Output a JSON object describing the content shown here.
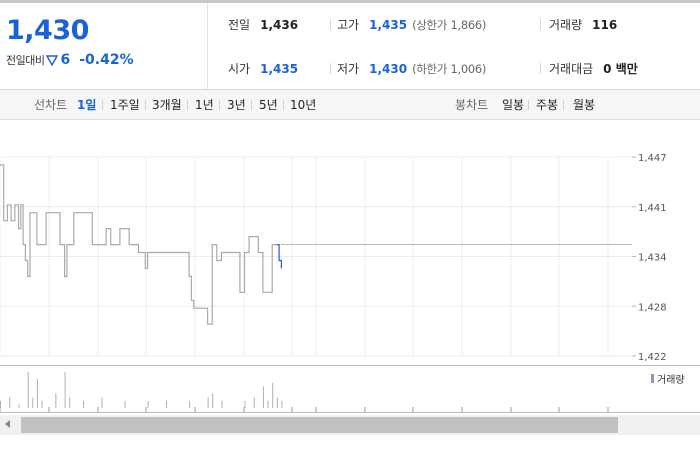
{
  "summary": {
    "current_price": "1,430",
    "change_label": "전일대비",
    "change_amount": "6",
    "change_pct": "-0.42%",
    "prev_close": {
      "label": "전일",
      "value": "1,436"
    },
    "open": {
      "label": "시가",
      "value": "1,435"
    },
    "high": {
      "label": "고가",
      "value": "1,435",
      "limit": "(상한가 1,866)"
    },
    "low": {
      "label": "저가",
      "value": "1,430",
      "limit": "(하한가 1,006)"
    },
    "volume": {
      "label": "거래량",
      "value": "116"
    },
    "trade_value": {
      "label": "거래대금",
      "value": "0 백만"
    }
  },
  "tabs": {
    "line_chart_label": "선차트",
    "line_chart_periods": [
      "1일",
      "1주일",
      "3개월",
      "1년",
      "3년",
      "5년",
      "10년"
    ],
    "candle_chart_label": "봉차트",
    "candle_chart_periods": [
      "일봉",
      "주봉",
      "월봉"
    ],
    "active_period": "1일"
  },
  "chart_data": {
    "type": "line",
    "y_ticks": [
      "1,447",
      "1,441",
      "1,434",
      "1,428",
      "1,422"
    ],
    "ylim": [
      1422,
      1447
    ],
    "prev_close_reference": 1436,
    "grid": true,
    "series": [
      {
        "points": [
          [
            0,
            1446
          ],
          [
            0.8,
            1439
          ],
          [
            1.6,
            1441
          ],
          [
            2.4,
            1439
          ],
          [
            3.2,
            1441
          ],
          [
            4,
            1438
          ],
          [
            4.5,
            1441
          ],
          [
            5,
            1436
          ],
          [
            5.5,
            1434
          ],
          [
            6,
            1432
          ],
          [
            6.5,
            1440
          ],
          [
            7,
            1440
          ],
          [
            8,
            1436
          ],
          [
            9,
            1436
          ],
          [
            10,
            1440
          ],
          [
            11,
            1440
          ],
          [
            12,
            1440
          ],
          [
            13,
            1436
          ],
          [
            14,
            1432
          ],
          [
            14.5,
            1436
          ],
          [
            15,
            1436
          ],
          [
            16,
            1440
          ],
          [
            17,
            1440
          ],
          [
            18,
            1440
          ],
          [
            19,
            1440
          ],
          [
            20,
            1436
          ],
          [
            21,
            1436
          ],
          [
            22,
            1436
          ],
          [
            23,
            1438
          ],
          [
            24,
            1436
          ],
          [
            25,
            1436
          ],
          [
            26,
            1438
          ],
          [
            27,
            1438
          ],
          [
            28,
            1436
          ],
          [
            29,
            1436
          ],
          [
            30,
            1435
          ],
          [
            31,
            1435
          ],
          [
            31.5,
            1433
          ],
          [
            32,
            1435
          ],
          [
            33,
            1435
          ],
          [
            34,
            1435
          ],
          [
            35,
            1435
          ],
          [
            36,
            1435
          ],
          [
            37,
            1435
          ],
          [
            38,
            1435
          ],
          [
            39,
            1435
          ],
          [
            40,
            1435
          ],
          [
            41,
            1432
          ],
          [
            41.5,
            1429
          ],
          [
            42,
            1428
          ],
          [
            43,
            1428
          ],
          [
            44,
            1428
          ],
          [
            45,
            1426
          ],
          [
            46,
            1436
          ],
          [
            47,
            1434
          ],
          [
            48,
            1435
          ],
          [
            49,
            1435
          ],
          [
            50,
            1435
          ],
          [
            51,
            1435
          ],
          [
            52,
            1430
          ],
          [
            53,
            1435
          ],
          [
            54,
            1437
          ],
          [
            55,
            1437
          ],
          [
            56,
            1435
          ],
          [
            57,
            1430
          ],
          [
            58,
            1430
          ],
          [
            59,
            1436
          ],
          [
            60,
            1436
          ]
        ],
        "color": "#aaaaaa"
      },
      {
        "points": [
          [
            60,
            1436
          ],
          [
            60.5,
            1434
          ],
          [
            61,
            1433
          ]
        ],
        "color": "#1a62d6"
      }
    ],
    "volume": {
      "legend": "거래량",
      "color": "#9a8fc6",
      "bars": [
        [
          0,
          2
        ],
        [
          2,
          3
        ],
        [
          4,
          1
        ],
        [
          6,
          10
        ],
        [
          7,
          3
        ],
        [
          8,
          8
        ],
        [
          9,
          2
        ],
        [
          12,
          4
        ],
        [
          14,
          10
        ],
        [
          15,
          3
        ],
        [
          18,
          2
        ],
        [
          22,
          3
        ],
        [
          27,
          2
        ],
        [
          32,
          2
        ],
        [
          36,
          2
        ],
        [
          41,
          2
        ],
        [
          45,
          3
        ],
        [
          46,
          4
        ],
        [
          48,
          2
        ],
        [
          53,
          2
        ],
        [
          55,
          3
        ],
        [
          57,
          6
        ],
        [
          58,
          2
        ],
        [
          59,
          7
        ],
        [
          60,
          3
        ],
        [
          61,
          2
        ]
      ],
      "ylim": [
        0,
        10
      ]
    }
  },
  "scrollbar": {
    "left_arrow_icon": "scroll-left-arrow-icon"
  }
}
